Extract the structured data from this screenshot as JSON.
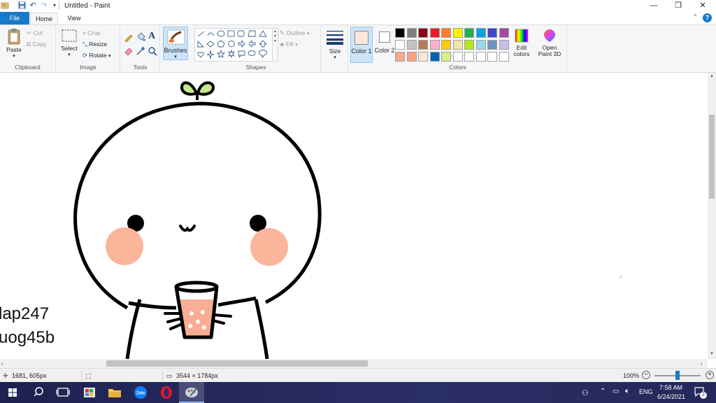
{
  "window": {
    "title": "Untitled - Paint",
    "minimize": "—",
    "restore": "❐",
    "close": "✕"
  },
  "tabs": {
    "file": "File",
    "home": "Home",
    "view": "View"
  },
  "ribbon": {
    "clipboard": {
      "group": "Clipboard",
      "paste": "Paste",
      "cut": "Cut",
      "copy": "Copy"
    },
    "image": {
      "group": "Image",
      "select": "Select",
      "crop": "Crop",
      "resize": "Resize",
      "rotate": "Rotate"
    },
    "tools": {
      "group": "Tools"
    },
    "brushes": "Brushes",
    "shapes": {
      "group": "Shapes",
      "outline": "Outline",
      "fill": "Fill"
    },
    "size": "Size",
    "colors": {
      "group": "Colors",
      "color1": "Color 1",
      "color2": "Color 2",
      "edit": "Edit colors",
      "paint3d": "Open Paint 3D",
      "color1_value": "#fde7dc",
      "color2_value": "#ffffff",
      "palette": [
        [
          "#000000",
          "#7f7f7f",
          "#880015",
          "#ed1c24",
          "#ff7f27",
          "#fff200",
          "#22b14c",
          "#00a2e8",
          "#3f48cc",
          "#a349a4"
        ],
        [
          "#ffffff",
          "#c3c3c3",
          "#b97a57",
          "#ffaec9",
          "#ffc90e",
          "#efe4b0",
          "#b5e61d",
          "#99d9ea",
          "#7092be",
          "#c8bfe7"
        ],
        [
          "#f7a98b",
          "#f9a183",
          "#fde7dc",
          "#0063b1",
          "#d6ef8a",
          "#ffffff",
          "#ffffff",
          "#ffffff",
          "#ffffff",
          "#ffffff"
        ]
      ]
    }
  },
  "canvas": {
    "text_line1": "lap247",
    "text_line2": "uog45b",
    "cheek_color": "#fbb59b",
    "sprout_color": "#c5e88f",
    "drink_color": "#f9ad94"
  },
  "status": {
    "cursor": "1681, 605px",
    "image_size": "3544 × 1784px",
    "zoom": "100%"
  },
  "taskbar": {
    "lang": "ENG",
    "time": "7:58 AM",
    "date": "6/24/2021",
    "notifications": "2"
  }
}
